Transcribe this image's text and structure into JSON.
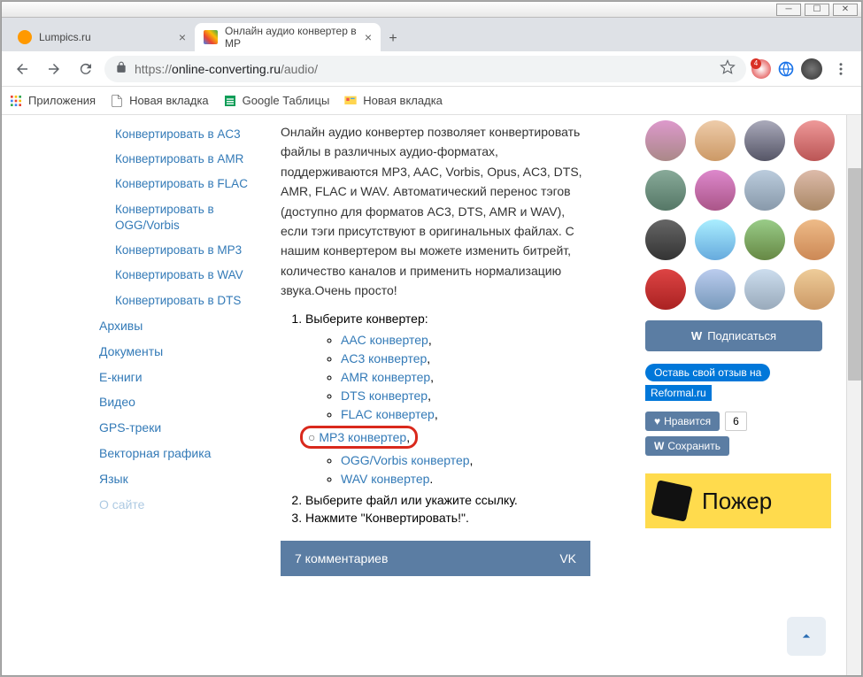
{
  "tabs": [
    {
      "title": "Lumpics.ru"
    },
    {
      "title": "Онлайн аудио конвертер в MP"
    }
  ],
  "url": {
    "proto": "https://",
    "host": "online-converting.ru",
    "path": "/audio/"
  },
  "ext_badge": "4",
  "bookmarks": {
    "apps": "Приложения",
    "items": [
      "Новая вкладка",
      "Google Таблицы",
      "Новая вкладка"
    ]
  },
  "sidebar": {
    "sub": [
      "Конвертировать в AC3",
      "Конвертировать в AMR",
      "Конвертировать в FLAC",
      "Конвертировать в OGG/Vorbis",
      "Конвертировать в MP3",
      "Конвертировать в WAV",
      "Конвертировать в DTS"
    ],
    "main": [
      "Архивы",
      "Документы",
      "Е-книги",
      "Видео",
      "GPS-треки",
      "Векторная графика",
      "Язык",
      "О сайте"
    ]
  },
  "content": {
    "description": "Онлайн аудио конвертер позволяет конвертировать файлы в различных аудио-форматах, поддерживаются MP3, AAC, Vorbis, Opus, AC3, DTS, AMR, FLAC и WAV. Автоматический перенос тэгов (доступно для форматов AC3, DTS, AMR и WAV), если тэги присутствуют в оригинальных файлах. С нашим конвертером вы можете изменить битрейт, количество каналов и применить нормализацию звука.Очень просто!",
    "step1": "Выберите конвертер:",
    "converters": [
      "AAC конвертер",
      "AC3 конвертер",
      "AMR конвертер",
      "DTS конвертер",
      "FLAC конвертер",
      "MP3 конвертер",
      "OGG/Vorbis конвертер",
      "WAV конвертер"
    ],
    "step2": "Выберите файл или укажите ссылку.",
    "step3": "Нажмите \"Конвертировать!\".",
    "comments_label": "7 комментариев",
    "vk_label": "VK"
  },
  "right": {
    "subscribe": "Подписаться",
    "review1": "Оставь свой отзыв на",
    "review2": "Reformal.ru",
    "like": "Нравится",
    "like_count": "6",
    "save": "Сохранить",
    "banner": "Пожер"
  }
}
